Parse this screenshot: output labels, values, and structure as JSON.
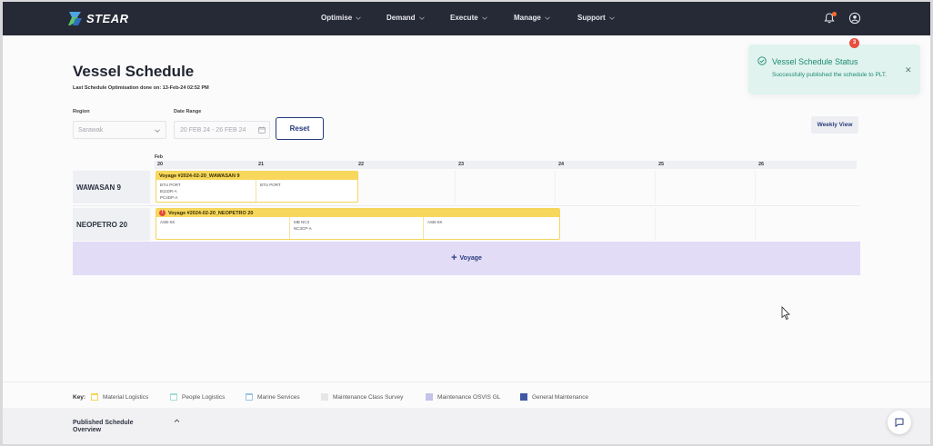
{
  "nav": {
    "brand": "STEAR",
    "items": [
      "Optimise",
      "Demand",
      "Execute",
      "Manage",
      "Support"
    ],
    "notification_count": "3"
  },
  "toast": {
    "title": "Vessel Schedule Status",
    "message": "Successfully published the schedule to PLT."
  },
  "page": {
    "title": "Vessel Schedule",
    "last_optimised": "Last Schedule Optimisation done on: 13-Feb-24 02:52 PM"
  },
  "filters": {
    "region_label": "Region",
    "region_value": "Sarawak",
    "date_label": "Date Range",
    "date_value": "20 FEB 24 - 26 FEB 24",
    "reset_label": "Reset",
    "weekly_view_label": "Weekly View"
  },
  "schedule": {
    "month": "Feb",
    "days": [
      "20",
      "21",
      "22",
      "23",
      "24",
      "25",
      "26"
    ],
    "vessels": [
      {
        "name": "WAWASAN 9",
        "voyage": "Voyage #2024-02-20_WAWASAN 9",
        "warning": false,
        "stops": [
          {
            "lines": [
              "BTU PORT",
              "B11DR-A",
              "PC4DP-A"
            ]
          },
          {
            "lines": [
              "BTU PORT"
            ]
          }
        ]
      },
      {
        "name": "NEOPETRO 20",
        "voyage": "Voyage #2024-02-20_NEOPETRO 20",
        "warning": true,
        "stops": [
          {
            "lines": [
              "ASB-SK"
            ]
          },
          {
            "lines": [
              "MB NC3",
              "NC3CP-A"
            ]
          },
          {
            "lines": [
              "ASB-SK"
            ]
          }
        ]
      }
    ],
    "add_voyage_label": "Voyage"
  },
  "key": {
    "label": "Key:",
    "items": [
      {
        "label": "Material Logistics",
        "color": "#f5d55a",
        "fill": "#ffffff"
      },
      {
        "label": "People Logistics",
        "color": "#a7ddd8",
        "fill": "#ffffff"
      },
      {
        "label": "Marine Services",
        "color": "#9cc3e6",
        "fill": "#ffffff"
      },
      {
        "label": "Maintenance Class Survey",
        "color": "#e6e6e8",
        "fill": "#e6e6e8"
      },
      {
        "label": "Maintenance OSVIS GL",
        "color": "#c4c2e8",
        "fill": "#c4c2e8"
      },
      {
        "label": "General Maintenance",
        "color": "#3f57a4",
        "fill": "#3f57a4"
      }
    ]
  },
  "footer": {
    "published_title": "Published Schedule Overview"
  }
}
